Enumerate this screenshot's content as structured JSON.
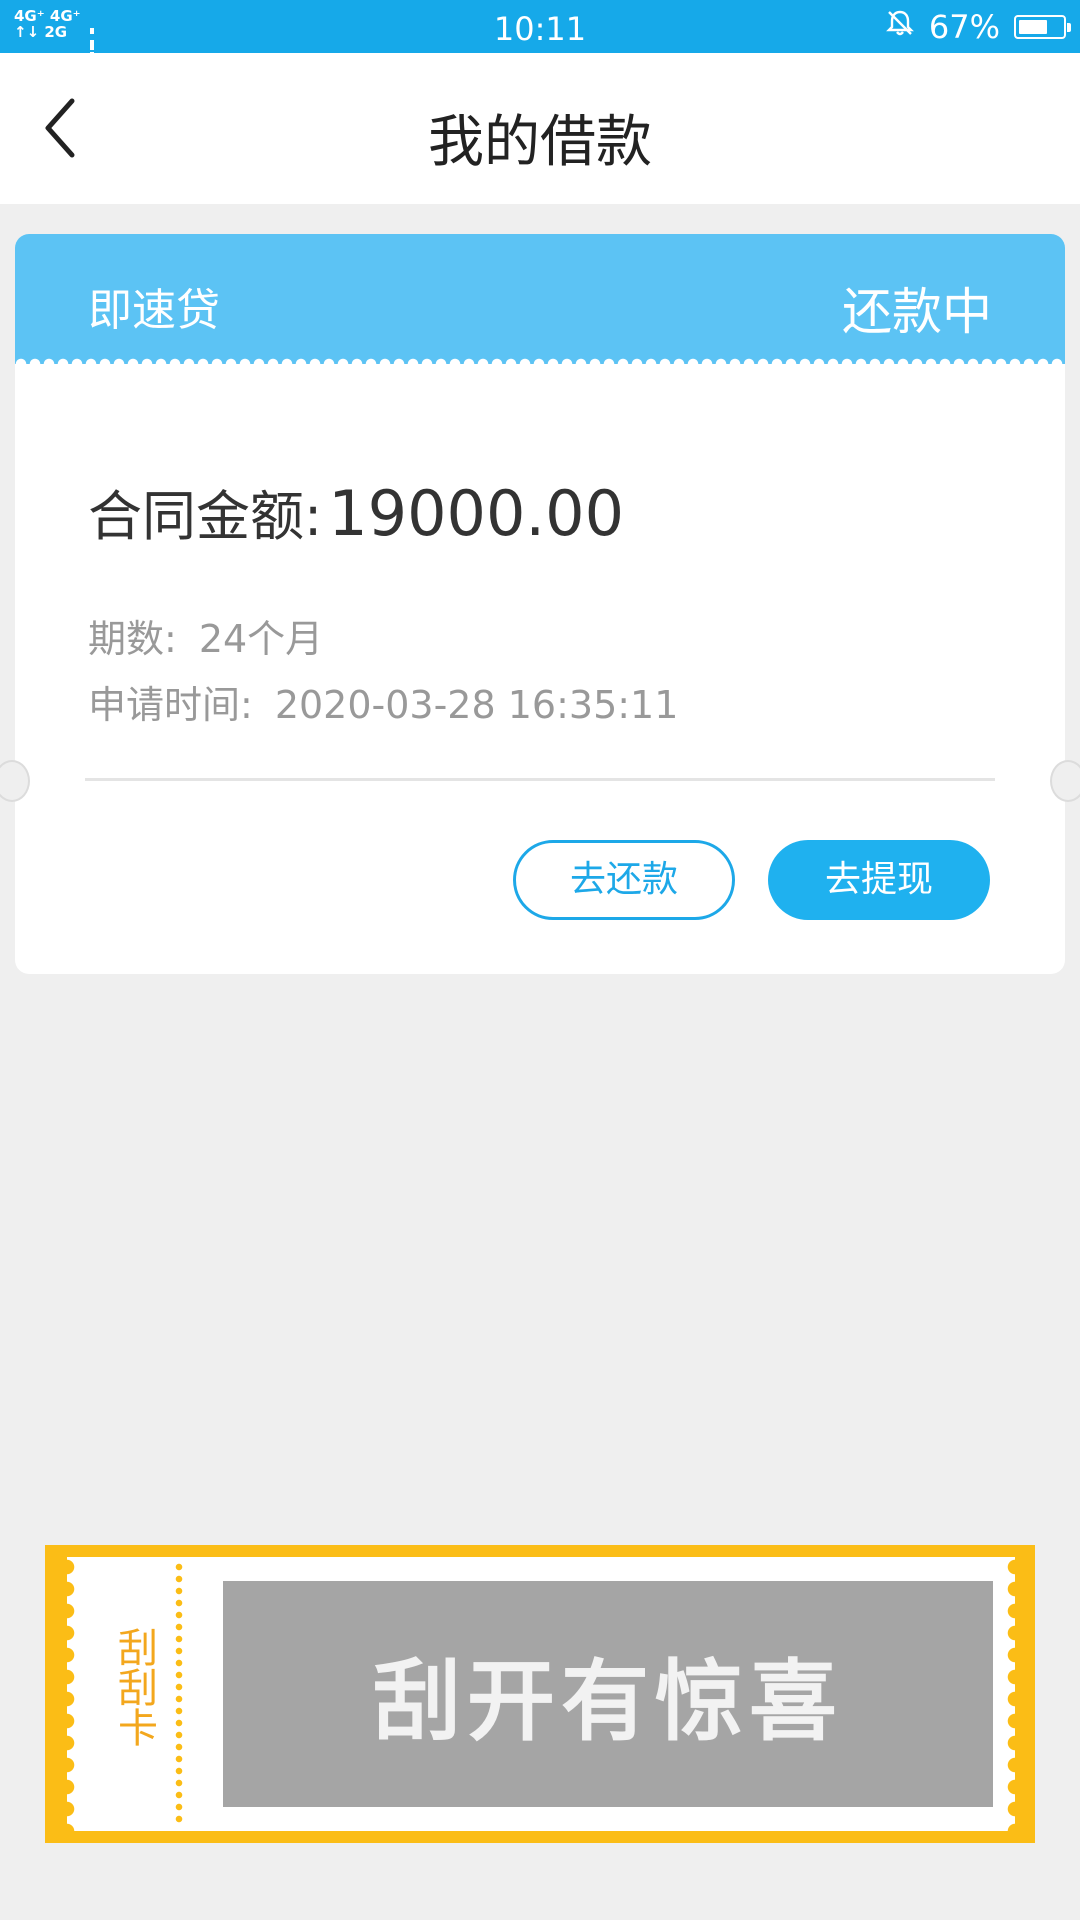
{
  "status_bar": {
    "network": "4G⁺ 4G⁺",
    "network2": "↑↓ 2G",
    "time": "10:11",
    "battery": "67%",
    "battery_level": 0.67
  },
  "header": {
    "title": "我的借款",
    "back_icon": "chevron-left-icon"
  },
  "loan": {
    "product": "即速贷",
    "status": "还款中",
    "amount_label": "合同金额:",
    "amount_value": "19000.00",
    "term_label": "期数:",
    "term_value": "24个月",
    "apply_label": "申请时间:",
    "apply_value": "2020-03-28 16:35:11",
    "repay_button": "去还款",
    "withdraw_button": "去提现"
  },
  "scratch_card": {
    "label": "刮刮卡",
    "prompt": "刮开有惊喜"
  },
  "colors": {
    "status_bar": "#16a9e9",
    "card_header": "#5cc3f4",
    "accent": "#1fb1ef",
    "scratch_border": "#fbbd16"
  }
}
